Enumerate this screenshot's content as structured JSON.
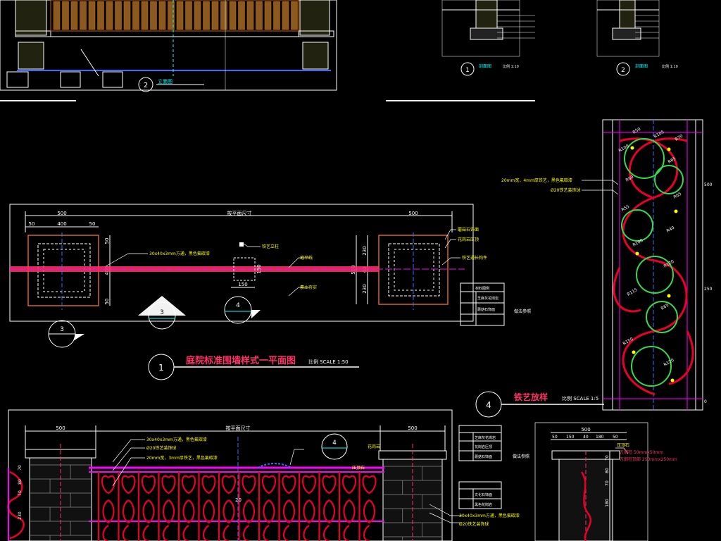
{
  "colors": {
    "background": "#000000",
    "line": "#ffffff",
    "dimension": "#ffffff",
    "callout": "#ffff00",
    "rail": "#ff3366",
    "ornament_red": "#e8002a",
    "ornament_green": "#39d84a",
    "magenta": "#ff00ff",
    "cyan": "#00ffff",
    "orange": "#d2691e",
    "blue": "#3a6cff"
  },
  "top_left_drawing": {
    "view_number": "2",
    "view_title": "立面图"
  },
  "top_right_drawing": {
    "left_view_number": "1",
    "left_view_title": "剖面图",
    "left_scale": "比例 1:10",
    "right_view_number": "2",
    "right_view_title": "剖面图",
    "right_scale": "比例 1:10"
  },
  "plan_view": {
    "total_dim_label": "按平面尺寸",
    "left_pier_width": "500",
    "left_sub_dims": [
      "50",
      "400",
      "50"
    ],
    "left_side_dims": [
      "50",
      "400",
      "50"
    ],
    "right_pier_width": "500",
    "right_side_dims": [
      "230",
      "40",
      "230"
    ],
    "right_total_dim": "500",
    "mid_dims": [
      "150",
      "150"
    ],
    "rail_callout": "30x40x3mm方通，黑色氟碳漆",
    "post_callout": "铁艺立柱",
    "pier_callouts": [
      "蘑菇石饰面",
      "花岗岩压顶",
      "铁艺通长构件"
    ],
    "ground_callouts": [
      "地平线",
      "素土夯实"
    ],
    "section_marks": [
      "3",
      "3",
      "4"
    ],
    "legend_title": "材料图例",
    "legend_rows": [
      "芝麻灰花岗岩",
      "蘑菇石饰面"
    ],
    "note": "做法参照"
  },
  "plan_title": {
    "number": "1",
    "name": "庭院标准围墙样式一平面图",
    "scale": "比例 SCALE 1:50"
  },
  "ironwork": {
    "number": "4",
    "name": "铁艺放样",
    "scale": "比例 SCALE 1:5",
    "callouts": [
      "20mm宽，4mm厚铁艺，黑色氟碳漆",
      "Ø20铁艺装饰球"
    ],
    "radius_labels": [
      "R50",
      "R105",
      "R70",
      "R100",
      "R65",
      "R60",
      "R65",
      "R55",
      "R40",
      "R100",
      "R120",
      "R115",
      "R65",
      "R150",
      "R120"
    ],
    "scale_marks": [
      "500",
      "250",
      "0"
    ]
  },
  "elevation_view": {
    "total_dim_label": "按平面尺寸",
    "left_pier_width": "500",
    "right_pier_width": "500",
    "callouts": [
      "30x40x3mm方通，黑色氟碳漆",
      "Ø20铁艺装饰球",
      "20mm宽，3mm厚铁艺，黑色氟碳漆",
      "30x40x3mm方通，黑色氟碳漆",
      "Ø20铁艺装饰球"
    ],
    "left_dims": [
      "70",
      "80",
      "70",
      "230"
    ],
    "section_mark": "4",
    "center_label": "20",
    "legend_rows_a": [
      "芝麻灰花岗岩",
      "花岗岩压顶",
      "蘑菇石饰面"
    ],
    "legend_rows_b": [
      "文化石饰面",
      "黑色花岗岩"
    ],
    "note_a": "做法参照",
    "pier_labels": [
      "花岗岩",
      "压顶石"
    ]
  },
  "detail_section": {
    "top_dim": "500",
    "sub_dims": [
      "50",
      "150",
      "40",
      "180",
      "50"
    ],
    "side_dims": [
      "70",
      "80",
      "70",
      "180"
    ],
    "callouts": [
      "方钢柱 50mmx50mm",
      "方钢柱顶部 250mmx250mm"
    ],
    "label": "压顶石"
  }
}
